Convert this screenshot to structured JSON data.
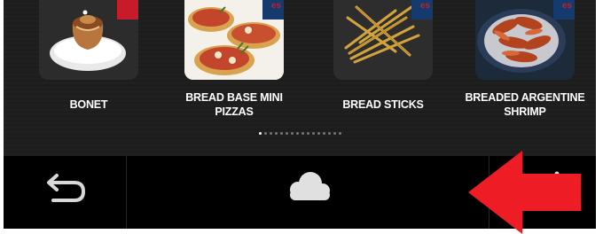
{
  "products": [
    {
      "name": "BONET",
      "thumb_icon": "bonet-dessert-image",
      "corner_color": "#c81b2a"
    },
    {
      "name": "BREAD BASE MINI PIZZAS",
      "thumb_icon": "mini-pizzas-image",
      "corner_color": "#143a6e"
    },
    {
      "name": "BREAD STICKS",
      "thumb_icon": "bread-sticks-image",
      "corner_color": "#143a6e"
    },
    {
      "name": "BREADED ARGENTINE SHRIMP",
      "thumb_icon": "breaded-shrimp-image",
      "corner_color": "#143a6e"
    }
  ],
  "pagination": {
    "total": 16,
    "active_index": 0
  },
  "navbar": {
    "back_icon": "back-arrow-icon",
    "center_icon": "cloud-icon",
    "right_icon": "menu-icon"
  },
  "annotation": {
    "icon": "red-arrow-annotation",
    "color": "#ee1c25"
  },
  "colors": {
    "background": "#1e1e1e",
    "navbar": "#000000",
    "text": "#ffffff"
  }
}
